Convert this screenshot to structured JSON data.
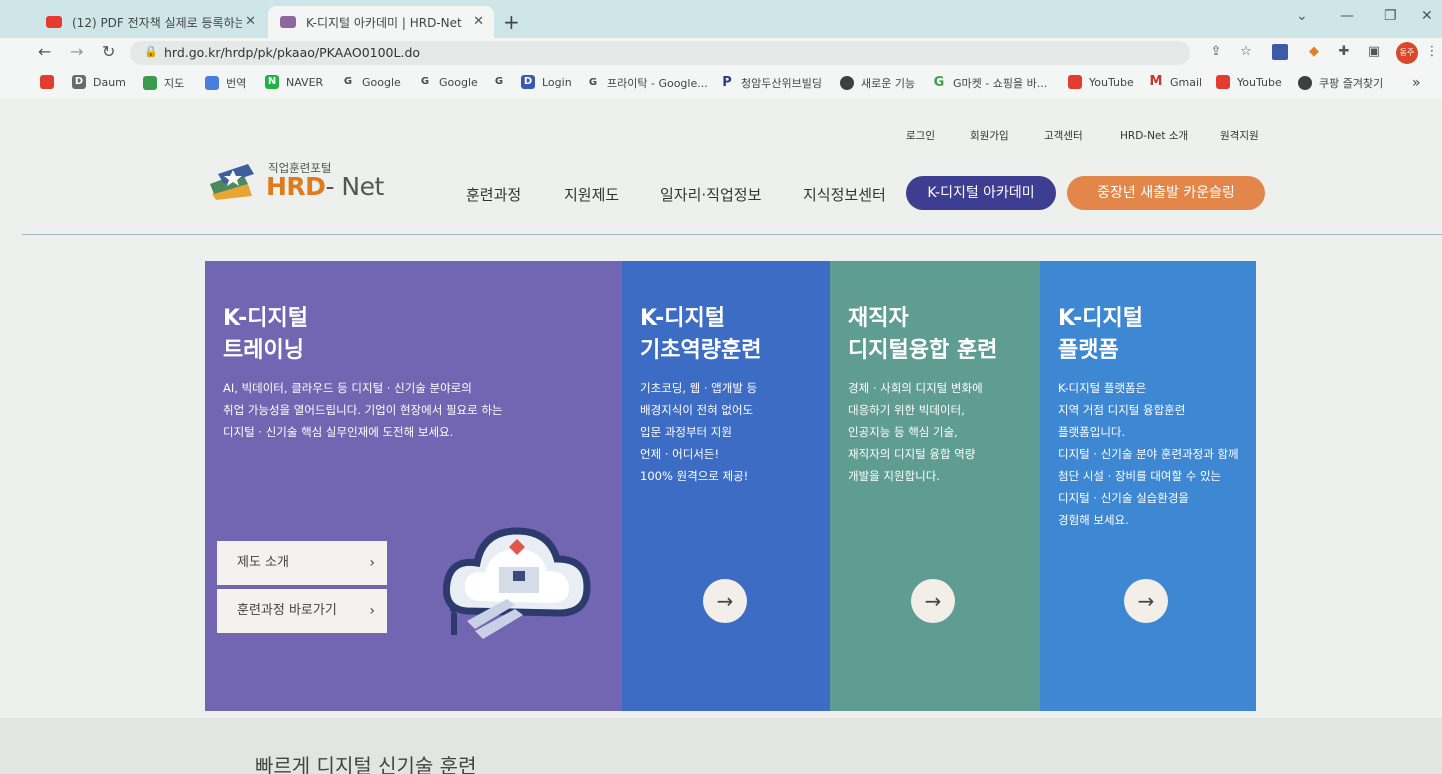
{
  "browser": {
    "tabs": [
      {
        "title": "(12) PDF 전자책 실제로 등록하는",
        "active": false,
        "favicon_color": "#e33b2e"
      },
      {
        "title": "K-디지털 아카데미 | HRD-Net",
        "active": true,
        "favicon_color": "#8c6a9e"
      }
    ],
    "url": "hrd.go.kr/hrdp/pk/pkaao/PKAAO0100L.do",
    "profile_label": "동주",
    "bookmarks": [
      {
        "label": "",
        "icon": "youtube-icon",
        "color": "#e33b2e"
      },
      {
        "label": "Daum",
        "icon": "daum-icon",
        "color": "#6a6a6a"
      },
      {
        "label": "지도",
        "icon": "map-icon",
        "color": "#3a9b4f"
      },
      {
        "label": "번역",
        "icon": "translate-icon",
        "color": "#4a7de0"
      },
      {
        "label": "NAVER",
        "icon": "naver-icon",
        "color": "#1fb343"
      },
      {
        "label": "Google",
        "icon": "google-icon",
        "color": "#4a4a4a"
      },
      {
        "label": "Google",
        "icon": "google-icon",
        "color": "#4a4a4a"
      },
      {
        "label": "",
        "icon": "google-icon",
        "color": "#4a4a4a"
      },
      {
        "label": "Login",
        "icon": "login-icon",
        "color": "#3a5ba9"
      },
      {
        "label": "프라이탁 - Google...",
        "icon": "google-icon",
        "color": "#4a4a4a"
      },
      {
        "label": "청암두산위브빌딩",
        "icon": "p-icon",
        "color": "#2a3a8f"
      },
      {
        "label": "새로운 기능",
        "icon": "chrome-icon",
        "color": "#3f3f3f"
      },
      {
        "label": "G마켓 - 쇼핑을 바...",
        "icon": "gmarket-icon",
        "color": "#3aa34a"
      },
      {
        "label": "YouTube",
        "icon": "youtube-icon",
        "color": "#e33b2e"
      },
      {
        "label": "Gmail",
        "icon": "gmail-icon",
        "color": "#c5372c"
      },
      {
        "label": "YouTube",
        "icon": "youtube-icon",
        "color": "#e33b2e"
      },
      {
        "label": "쿠팡 즐겨찾기",
        "icon": "globe-icon",
        "color": "#3f3f3f"
      }
    ]
  },
  "utility_links": [
    "로그인",
    "회원가입",
    "고객센터",
    "HRD-Net 소개",
    "원격지원"
  ],
  "logo": {
    "sub": "직업훈련포털",
    "brand_main": "HRD",
    "brand_net": "- Net"
  },
  "gnb": [
    "훈련과정",
    "지원제도",
    "일자리·직업정보",
    "지식정보센터"
  ],
  "pills": {
    "academy": "K-디지털 아카데미",
    "counseling": "중장년 새출발 카운슬링"
  },
  "panels": [
    {
      "title": [
        "K-디지털",
        "트레이닝"
      ],
      "desc": [
        "AI, 빅데이터, 클라우드 등 디지털 · 신기술 분야로의",
        "취업 가능성을 열어드립니다. 기업이 현장에서 필요로 하는",
        "디지털 · 신기술 핵심 실무인재에 도전해 보세요."
      ],
      "buttons": [
        "제도 소개",
        "훈련과정 바로가기"
      ]
    },
    {
      "title": [
        "K-디지털",
        "기초역량훈련"
      ],
      "desc": [
        "기초코딩, 웹 · 앱개발 등",
        "배경지식이 전혀 없어도",
        "입문 과정부터 지원",
        "언제 · 어디서든!",
        "100% 원격으로 제공!"
      ]
    },
    {
      "title": [
        "재직자",
        "디지털융합 훈련"
      ],
      "desc": [
        "경제 · 사회의 디지털 변화에",
        "대응하기 위한 빅데이터,",
        "인공지능 등 핵심 기술,",
        "재직자의 디지털 융합 역량",
        "개발을 지원합니다."
      ]
    },
    {
      "title": [
        "K-디지털",
        "플랫폼"
      ],
      "desc": [
        "K-디지털 플랫폼은",
        "지역 거점 디지털 융합훈련",
        "플랫폼입니다.",
        "디지털 · 신기술 분야 훈련과정과 함께",
        "첨단 시설 · 장비를 대여할 수 있는",
        "디지털 · 신기술 실습환경을",
        "경험해 보세요."
      ]
    }
  ],
  "arrow_glyph": "→",
  "next_section_heading": "빠르게 디지털 신기술 훈련"
}
